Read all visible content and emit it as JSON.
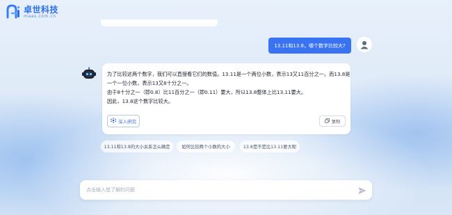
{
  "brand": {
    "name": "卓世科技",
    "domain": "maas.com.cn",
    "accent": "#2d6ef0"
  },
  "chat": {
    "user_question": "13.11和13.8，哪个数字比较大?",
    "answer_lines": [
      "为了比较这两个数字，我们可以直接看它们的数值。13.11是一个两位小数，表示13又11百分之一。而13.8是",
      "一个一位小数，表示13又8十分之一。",
      "由于8十分之一（即0.8）比11百分之一（即0.11）要大，所以13.8整体上比13.11要大。",
      "因此，13.8这个数字比较大。"
    ],
    "deep_research_label": "深入研究",
    "copy_label": "复制"
  },
  "suggestions": [
    "13.11和13.8的大小关系怎么确定",
    "如何比较两个小数的大小",
    "13.8是不是比13.11要大呢"
  ],
  "input": {
    "placeholder": "点击输入想了解的问题",
    "value": ""
  },
  "icons": {
    "logo": "logo-icon",
    "user": "user-avatar-icon",
    "bot": "robot-icon",
    "deep": "sparkle-icon",
    "copy": "copy-icon",
    "send": "send-icon"
  },
  "colors": {
    "user_bubble": "#3a73f2",
    "card": "#ffffff"
  }
}
